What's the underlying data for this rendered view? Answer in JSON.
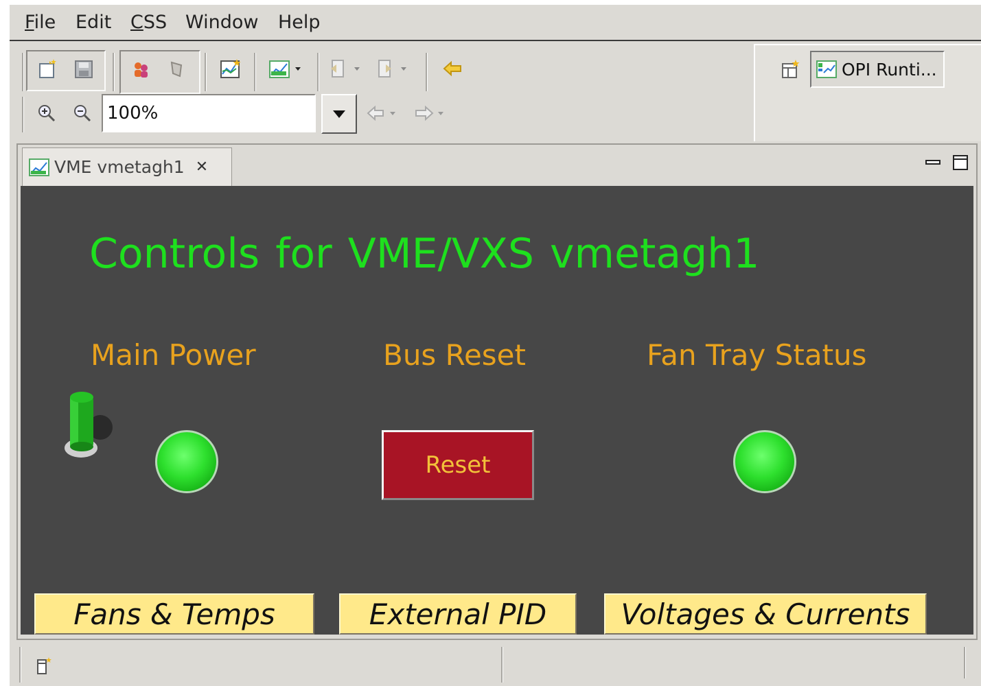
{
  "menu": {
    "file": "File",
    "edit": "Edit",
    "css": "CSS",
    "window": "Window",
    "help": "Help"
  },
  "toolbar": {
    "zoom_value": "100%"
  },
  "perspective": {
    "label": "OPI Runti..."
  },
  "editor_tab": {
    "label": "VME vmetagh1"
  },
  "display": {
    "title": "Controls for VME/VXS  vmetagh1",
    "main_power_label": "Main Power",
    "bus_reset_label": "Bus Reset",
    "fan_tray_label": "Fan Tray Status",
    "reset_button": "Reset",
    "fans_temps_button": "Fans & Temps",
    "external_pid_button": "External PID",
    "voltages_currents_button": "Voltages & Currents",
    "main_power_led": "on",
    "fan_tray_led": "on",
    "main_power_switch": "on"
  },
  "colors": {
    "canvas_bg": "#474747",
    "title_green": "#1ee01e",
    "label_orange": "#e8a21e",
    "reset_red": "#a81425",
    "link_yellow": "#ffe98a",
    "led_green": "#2ee02e"
  }
}
